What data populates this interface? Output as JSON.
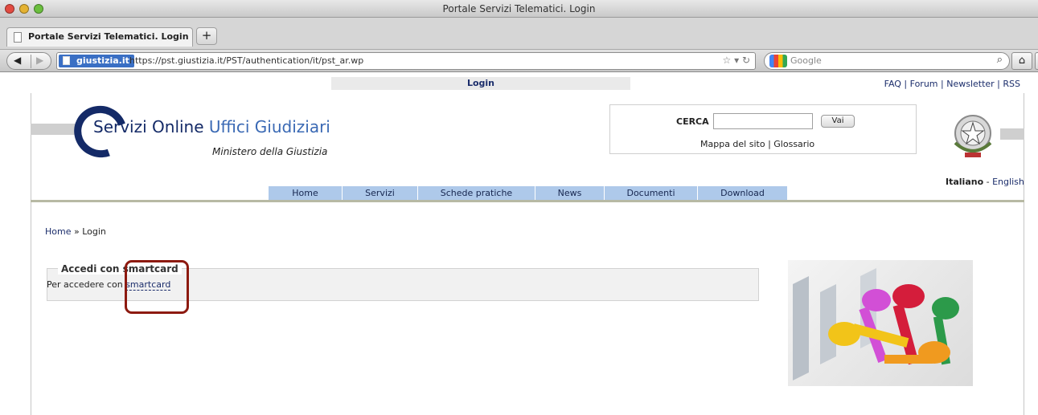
{
  "window": {
    "title": "Portale Servizi Telematici. Login"
  },
  "tabs": [
    {
      "label": "Portale Servizi Telematici. Login"
    }
  ],
  "toolbar": {
    "new_tab": "+",
    "site_identity": "giustizia.it",
    "url": "https://pst.giustizia.it/PST/authentication/it/pst_ar.wp",
    "search_engine_placeholder": "Google"
  },
  "page": {
    "login_strip": "Login",
    "top_links": [
      "FAQ",
      "Forum",
      "Newsletter",
      "RSS"
    ],
    "logo": {
      "title_main": "Servizi Online",
      "title_accent": "Uffici Giudiziari",
      "subtitle": "Ministero della Giustizia"
    },
    "search": {
      "label": "CERCA",
      "value": "",
      "button": "Vai",
      "links": [
        "Mappa del sito",
        "Glossario"
      ]
    },
    "language": {
      "current": "Italiano",
      "other": "English"
    },
    "menu": [
      {
        "label": "Home"
      },
      {
        "label": "Servizi"
      },
      {
        "label": "Schede pratiche"
      },
      {
        "label": "News"
      },
      {
        "label": "Documenti"
      },
      {
        "label": "Download"
      }
    ],
    "breadcrumb": {
      "home": "Home",
      "separator": "»",
      "current": "Login"
    },
    "smartcard": {
      "legend": "Accedi con smartcard",
      "text_prefix": "Per accedere con",
      "link": "smartcard"
    }
  },
  "colors": {
    "navy": "#142a67",
    "menu_bg": "#aec9ea",
    "highlight": "#8d1a10"
  }
}
